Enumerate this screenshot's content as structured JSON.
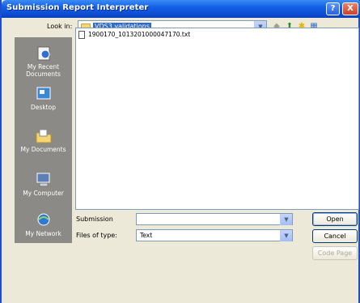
{
  "window": {
    "title": "Submission Report Interpreter"
  },
  "titlebar_buttons": {
    "help": "?",
    "close": "X"
  },
  "lookin": {
    "label": "Look in:",
    "value": "VDS3 validations"
  },
  "toolbar": {
    "back": "◆",
    "up": "⬆",
    "new_folder": "✱",
    "views": "▦"
  },
  "places": [
    {
      "label": "My Recent Documents",
      "icon": "recent-documents-icon"
    },
    {
      "label": "Desktop",
      "icon": "desktop-icon"
    },
    {
      "label": "My Documents",
      "icon": "my-documents-icon"
    },
    {
      "label": "My Computer",
      "icon": "my-computer-icon"
    },
    {
      "label": "My Network",
      "icon": "my-network-icon"
    }
  ],
  "files": [
    {
      "name": "1900170_1013201000047170.txt",
      "icon": "text-file-icon"
    }
  ],
  "filename": {
    "label": "Submission",
    "value": ""
  },
  "filetype": {
    "label": "Files of type:",
    "value": "Text"
  },
  "buttons": {
    "open": "Open",
    "cancel": "Cancel",
    "code_page": "Code Page"
  },
  "colors": {
    "titlebar": "#0b49d0",
    "selection": "#316ac5",
    "places_bg": "#8c8a86"
  }
}
